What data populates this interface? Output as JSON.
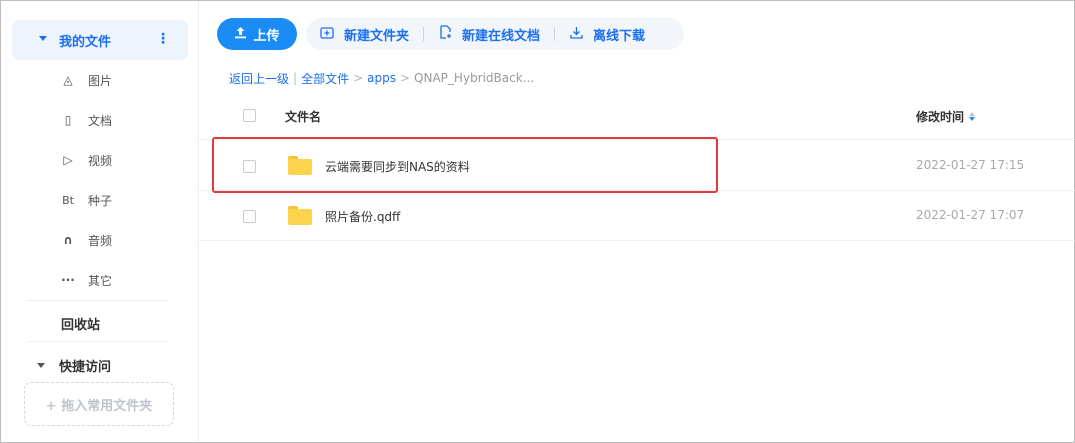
{
  "sidebar": {
    "my_files": "我的文件",
    "more_icon": "⋮",
    "items": [
      {
        "icon": "image-icon",
        "glyph": "◬",
        "label": "图片"
      },
      {
        "icon": "document-icon",
        "glyph": "▯",
        "label": "文档"
      },
      {
        "icon": "play-icon",
        "glyph": "▷",
        "label": "视频"
      },
      {
        "icon": "bt-icon",
        "glyph": "Bt",
        "label": "种子"
      },
      {
        "icon": "headphones-icon",
        "glyph": "∩",
        "label": "音频"
      },
      {
        "icon": "more-dots-icon",
        "glyph": "···",
        "label": "其它"
      }
    ],
    "recycle_bin": "回收站",
    "quick_access": "快捷访问",
    "drop_zone": "+ 拖入常用文件夹"
  },
  "toolbar": {
    "upload": "上传",
    "new_folder": "新建文件夹",
    "new_online_doc": "新建在线文档",
    "offline_download": "离线下载"
  },
  "breadcrumb": {
    "back": "返回上一级",
    "all_files": "全部文件",
    "apps": "apps",
    "current": "QNAP_HybridBack..."
  },
  "table": {
    "col_name": "文件名",
    "col_modified": "修改时间",
    "rows": [
      {
        "name": "云端需要同步到NAS的资料",
        "modified": "2022-01-27 17:15",
        "type": "folder"
      },
      {
        "name": "照片备份.qdff",
        "modified": "2022-01-27 17:07",
        "type": "folder"
      }
    ]
  },
  "colors": {
    "accent": "#1b8cf5",
    "link": "#1b6ff1",
    "folder": "#fcd34d",
    "highlight": "#e03a3a"
  }
}
